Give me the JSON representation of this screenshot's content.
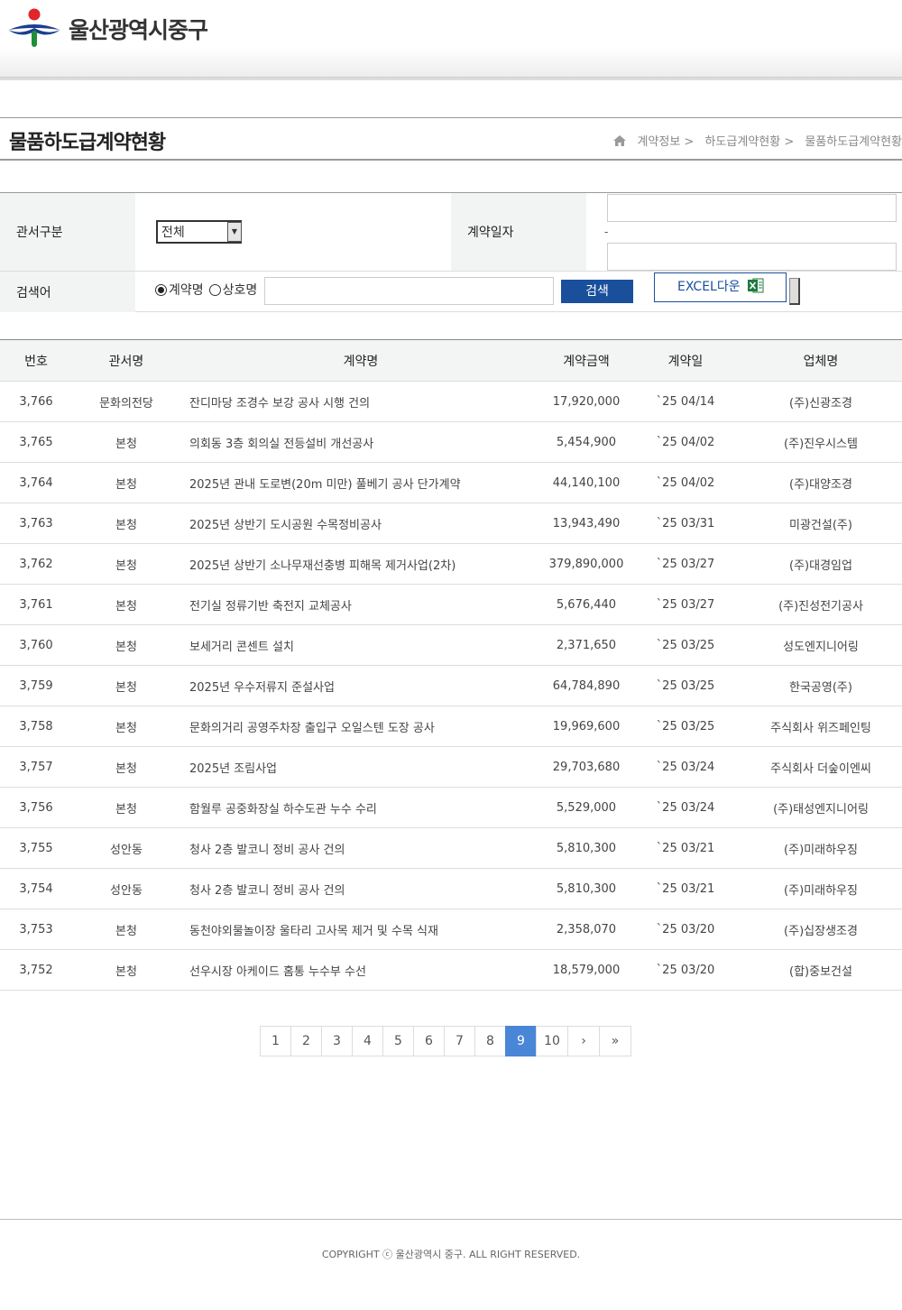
{
  "header": {
    "site_name": "울산광역시중구"
  },
  "title_bar": {
    "page_title": "물품하도급계약현황",
    "breadcrumb": [
      "계약정보 >",
      "하도급계약현황 >",
      "물품하도급계약현황"
    ]
  },
  "search": {
    "dept_label": "관서구분",
    "dept_value": "전체",
    "date_label": "계약일자",
    "date_separator": "-",
    "keyword_label": "검색어",
    "radio_contract": "계약명",
    "radio_company": "상호명",
    "search_button": "검색",
    "excel_button": "EXCEL다운"
  },
  "table": {
    "headers": [
      "번호",
      "관서명",
      "계약명",
      "계약금액",
      "계약일",
      "업체명"
    ],
    "rows": [
      [
        "3,766",
        "문화의전당",
        "잔디마당 조경수 보강 공사 시행 건의",
        "17,920,000",
        "`25 04/14",
        "(주)신광조경"
      ],
      [
        "3,765",
        "본청",
        "의회동 3층 회의실 전등설비 개선공사",
        "5,454,900",
        "`25 04/02",
        "(주)진우시스템"
      ],
      [
        "3,764",
        "본청",
        "2025년 관내 도로변(20m 미만) 풀베기 공사 단가계약",
        "44,140,100",
        "`25 04/02",
        "(주)대양조경"
      ],
      [
        "3,763",
        "본청",
        "2025년 상반기 도시공원 수목정비공사",
        "13,943,490",
        "`25 03/31",
        "미광건설(주)"
      ],
      [
        "3,762",
        "본청",
        "2025년 상반기 소나무재선충병 피해목 제거사업(2차)",
        "379,890,000",
        "`25 03/27",
        "(주)대경임업"
      ],
      [
        "3,761",
        "본청",
        "전기실 정류기반 축전지 교체공사",
        "5,676,440",
        "`25 03/27",
        "(주)진성전기공사"
      ],
      [
        "3,760",
        "본청",
        "보세거리 콘센트 설치",
        "2,371,650",
        "`25 03/25",
        "성도엔지니어링"
      ],
      [
        "3,759",
        "본청",
        "2025년 우수저류지 준설사업",
        "64,784,890",
        "`25 03/25",
        "한국공영(주)"
      ],
      [
        "3,758",
        "본청",
        "문화의거리 공영주차장 출입구 오일스텐 도장 공사",
        "19,969,600",
        "`25 03/25",
        "주식회사 위즈페인팅"
      ],
      [
        "3,757",
        "본청",
        "2025년 조림사업",
        "29,703,680",
        "`25 03/24",
        "주식회사 더숲이엔씨"
      ],
      [
        "3,756",
        "본청",
        "함월루 공중화장실 하수도관 누수 수리",
        "5,529,000",
        "`25 03/24",
        "(주)태성엔지니어링"
      ],
      [
        "3,755",
        "성안동",
        "청사 2층 발코니 정비 공사 건의",
        "5,810,300",
        "`25 03/21",
        "(주)미래하우징"
      ],
      [
        "3,754",
        "성안동",
        "청사 2층 발코니 정비 공사 건의",
        "5,810,300",
        "`25 03/21",
        "(주)미래하우징"
      ],
      [
        "3,753",
        "본청",
        "동천야외물놀이장 울타리 고사목 제거 및 수목 식재",
        "2,358,070",
        "`25 03/20",
        "(주)십장생조경"
      ],
      [
        "3,752",
        "본청",
        "선우시장 아케이드 홈통 누수부 수선",
        "18,579,000",
        "`25 03/20",
        "(합)중보건설"
      ]
    ]
  },
  "pagination": {
    "pages": [
      "1",
      "2",
      "3",
      "4",
      "5",
      "6",
      "7",
      "8",
      "9",
      "10"
    ],
    "current": "9",
    "next": "›",
    "last": "»"
  },
  "footer": {
    "copyright": "COPYRIGHT ⓒ 울산광역시 중구. ALL RIGHT RESERVED."
  },
  "colors": {
    "brand_blue": "#1a4f9c",
    "active_page": "#4a86d6",
    "logo_red": "#e2242b",
    "logo_green": "#1f8f3a"
  }
}
